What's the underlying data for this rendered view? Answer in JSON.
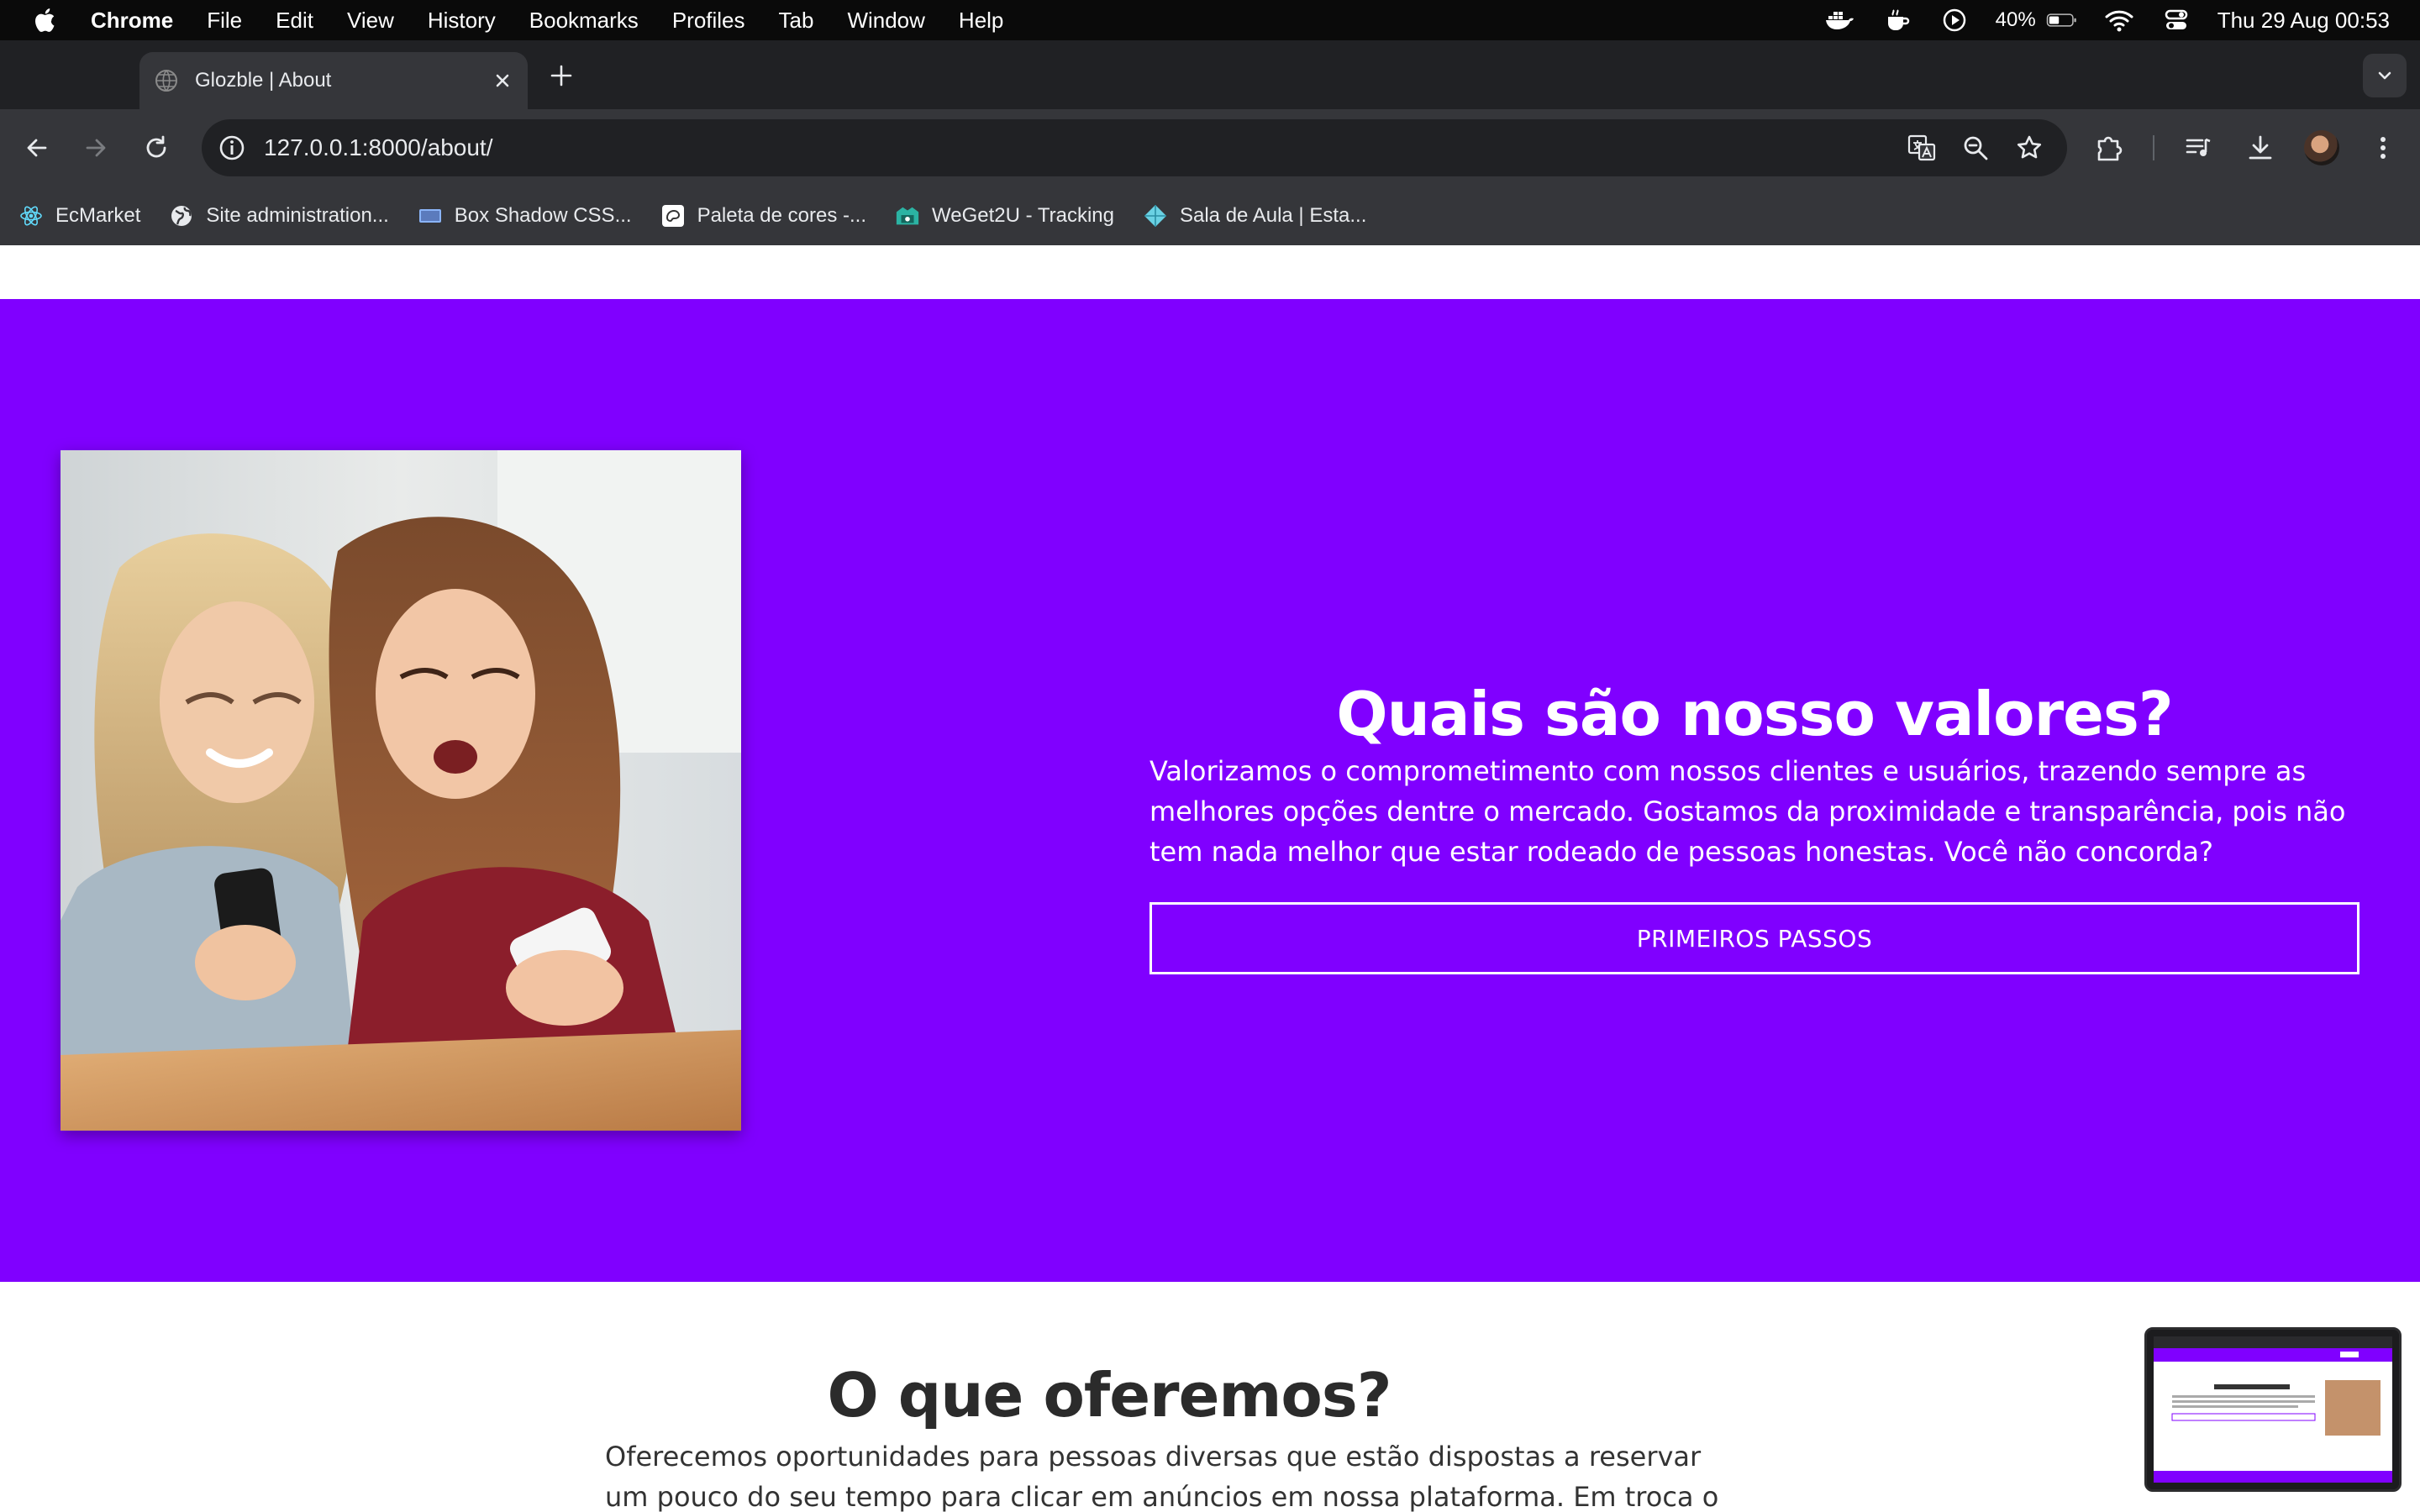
{
  "menubar": {
    "app_name": "Chrome",
    "items": [
      "File",
      "Edit",
      "View",
      "History",
      "Bookmarks",
      "Profiles",
      "Tab",
      "Window",
      "Help"
    ],
    "battery_percent": "40%",
    "clock": "Thu 29 Aug  00:53"
  },
  "browser": {
    "tab_title": "Glozble | About",
    "url": "127.0.0.1:8000/about/",
    "bookmarks": [
      {
        "label": "EcMarket",
        "icon": "react-icon"
      },
      {
        "label": "Site administration...",
        "icon": "globe-icon"
      },
      {
        "label": "Box Shadow CSS...",
        "icon": "box-shadow-icon"
      },
      {
        "label": "Paleta de cores -...",
        "icon": "palette-icon"
      },
      {
        "label": "WeGet2U - Tracking",
        "icon": "weget-icon"
      },
      {
        "label": "Sala de Aula | Esta...",
        "icon": "diamond-icon"
      }
    ]
  },
  "page": {
    "hero": {
      "title": "Quais são nosso valores?",
      "body": "Valorizamos o comprometimento com nossos clientes e usuários, trazendo sempre as melhores opções dentre o mercado. Gostamos da proximidade e transparência, pois não tem nada melhor que estar rodeado de pessoas honestas. Você não concorda?",
      "button_label": "PRIMEIROS PASSOS"
    },
    "offer": {
      "title": "O que oferemos?",
      "body": "Oferecemos oportunidades para pessoas diversas que estão dispostas a reservar um pouco do seu tempo para clicar em anúncios em nossa plataforma. Em troca o"
    }
  },
  "colors": {
    "brand_purple": "#8000ff",
    "menubar_bg": "#0a0a0a",
    "chrome_dark": "#202124",
    "chrome_toolbar": "#35363a"
  }
}
